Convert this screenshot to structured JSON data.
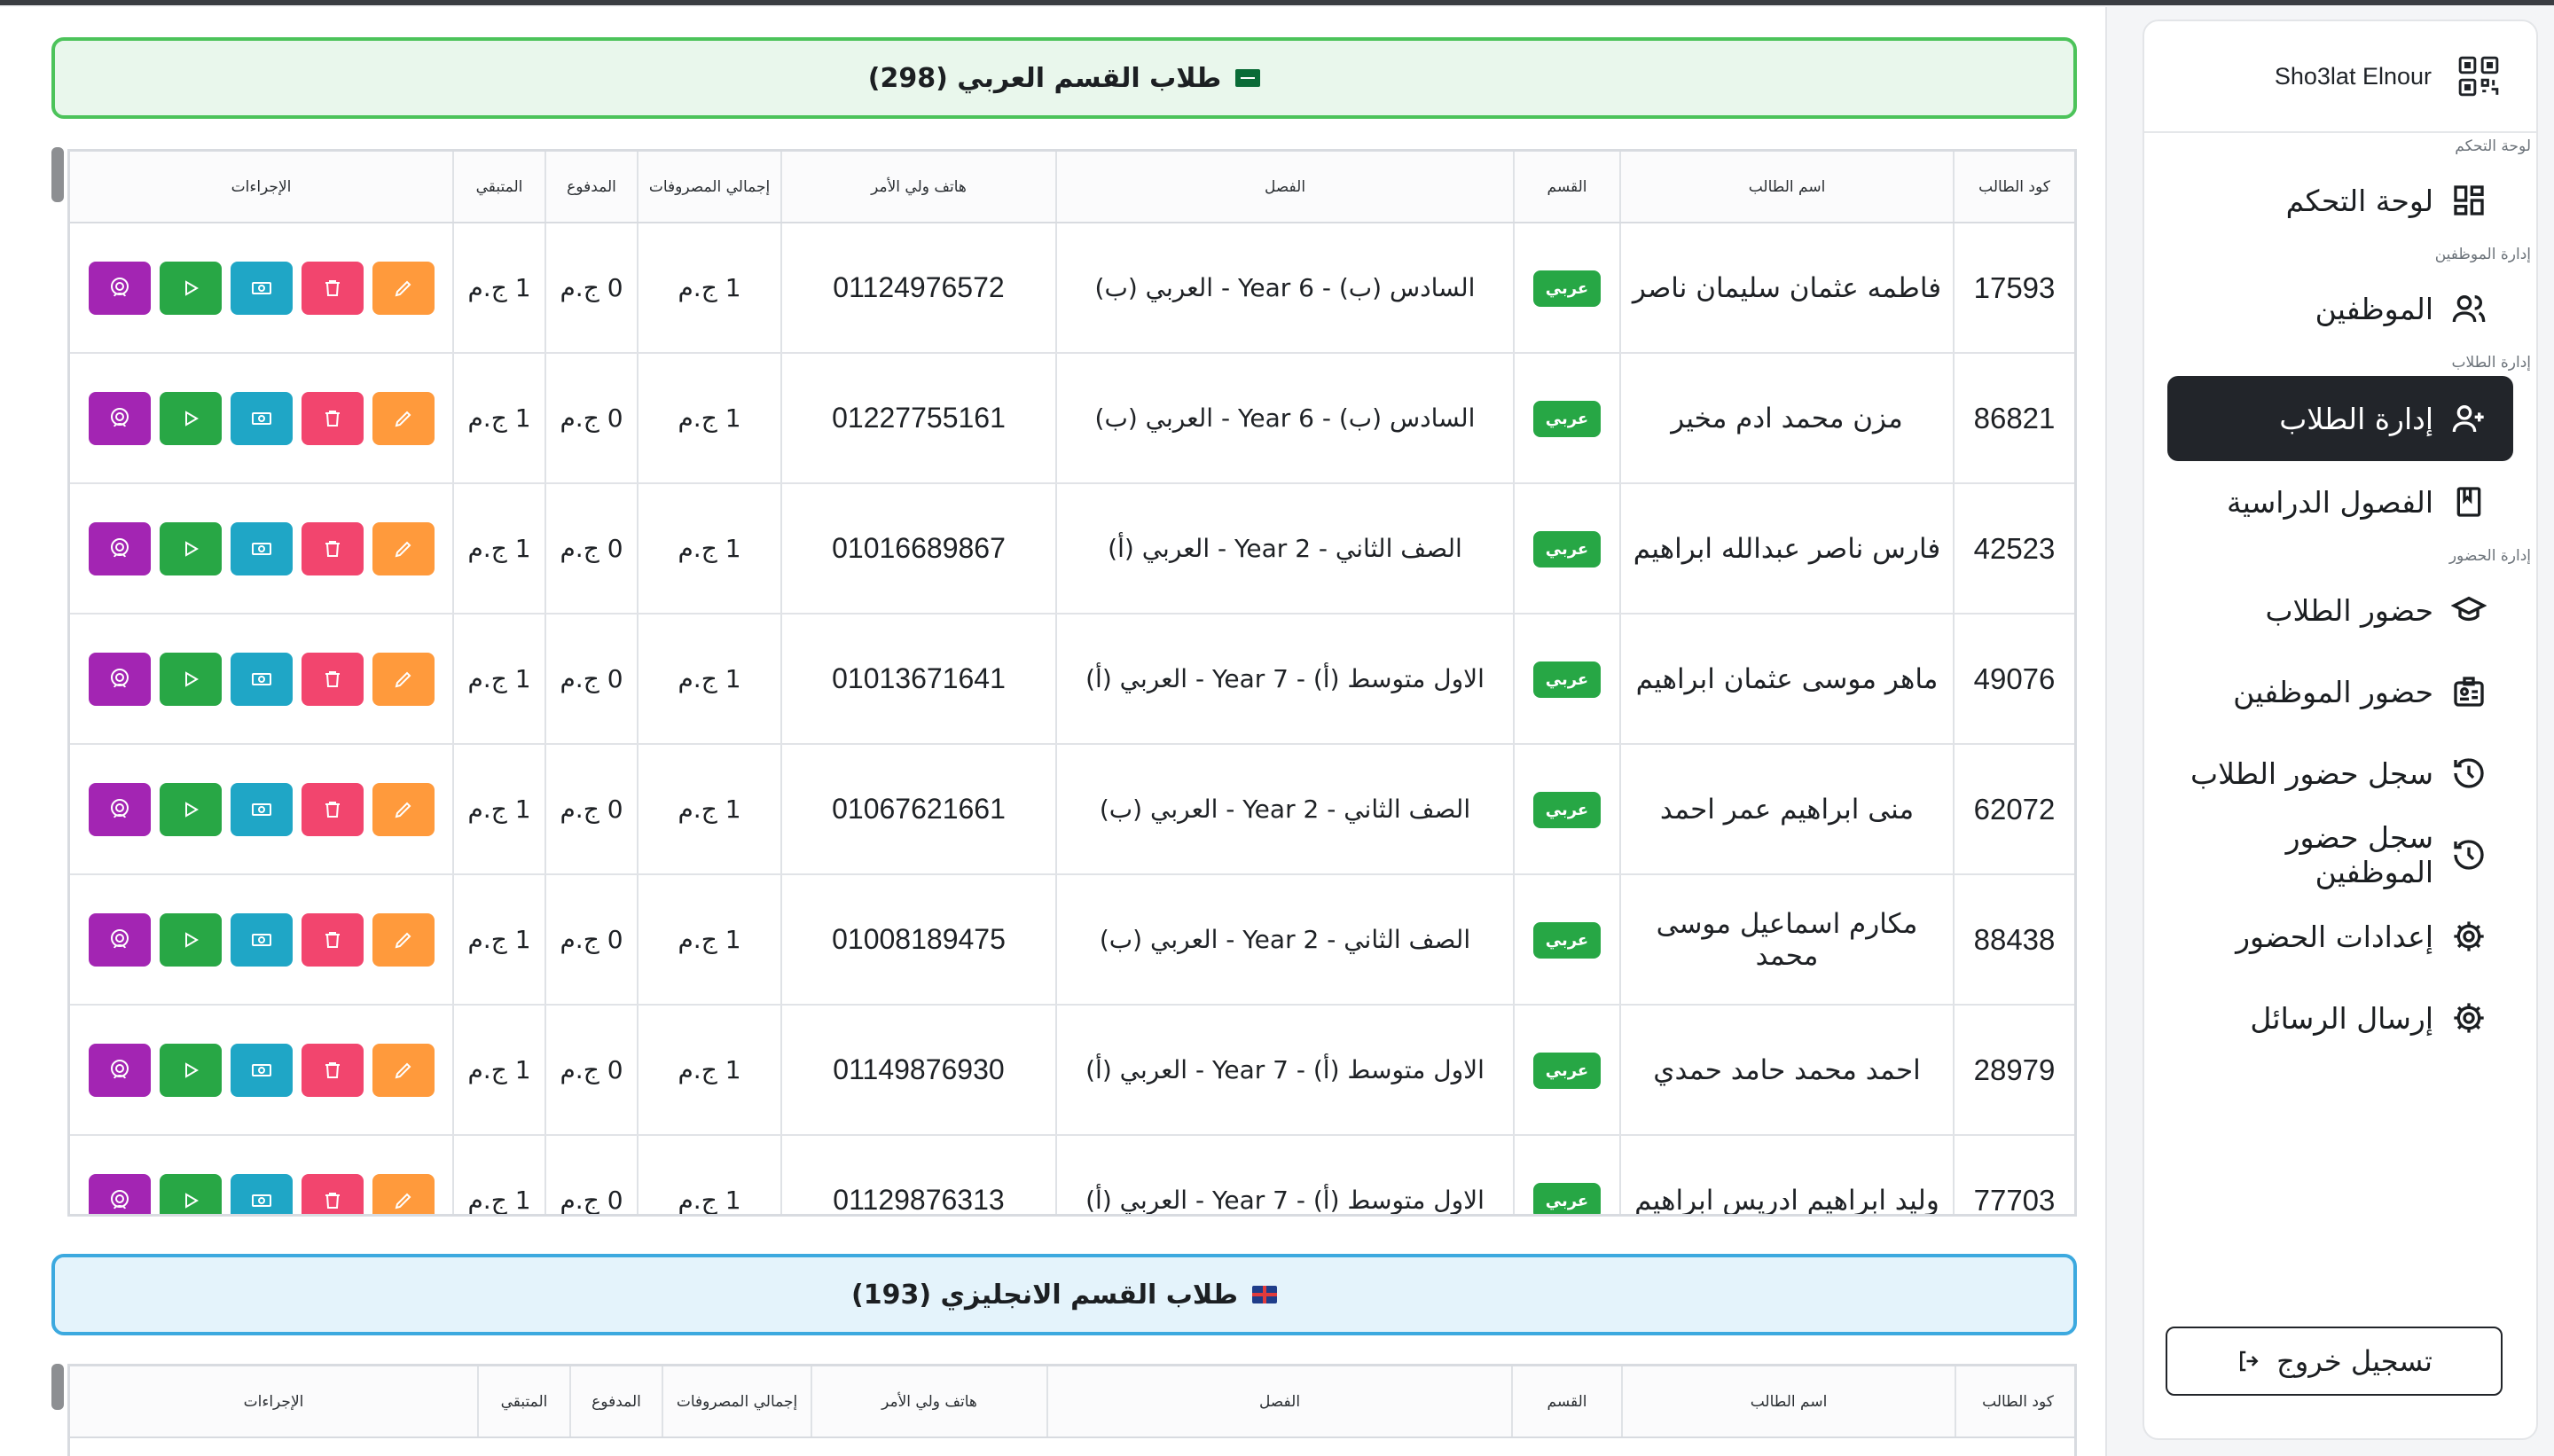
{
  "brand": {
    "name": "Sho3lat Elnour",
    "icon": "qr-boxes-icon"
  },
  "sidebar": {
    "sections": [
      {
        "label": "لوحة التحكم",
        "items": [
          {
            "label": "لوحة التحكم",
            "icon": "dashboard-grid-icon"
          }
        ]
      },
      {
        "label": "إدارة الموظفين",
        "items": [
          {
            "label": "الموظفين",
            "icon": "users-icon"
          }
        ]
      },
      {
        "label": "إدارة الطلاب",
        "items": [
          {
            "label": "إدارة الطلاب",
            "icon": "user-plus-icon",
            "active": true
          },
          {
            "label": "الفصول الدراسية",
            "icon": "book-icon"
          }
        ]
      },
      {
        "label": "إدارة الحضور",
        "items": [
          {
            "label": "حضور الطلاب",
            "icon": "graduation-cap-icon"
          },
          {
            "label": "حضور الموظفين",
            "icon": "id-badge-icon"
          },
          {
            "label": "سجل حضور الطلاب",
            "icon": "history-icon"
          },
          {
            "label": "سجل حضور الموظفين",
            "icon": "history-icon"
          },
          {
            "label": "إعدادات الحضور",
            "icon": "gear-icon"
          },
          {
            "label": "إرسال الرسائل",
            "icon": "gear-icon"
          }
        ]
      }
    ],
    "logout_label": "تسجيل خروج"
  },
  "arabic_section": {
    "title": "طلاب القسم العربي (298)",
    "columns": [
      "كود الطالب",
      "اسم الطالب",
      "القسم",
      "الفصل",
      "هاتف ولي الأمر",
      "إجمالي المصروفات",
      "المدفوع",
      "المتبقي",
      "الإجراءات"
    ],
    "rows": [
      {
        "code": "17593",
        "name": "فاطمه عثمان سليمان ناصر",
        "dept": "عربي",
        "class": "السادس (ب) - Year 6 - العربي (ب)",
        "phone": "01124976572",
        "total": "1 ج.م",
        "paid": "0 ج.م",
        "remaining": "1 ج.م"
      },
      {
        "code": "86821",
        "name": "مزن محمد ادم مخير",
        "dept": "عربي",
        "class": "السادس (ب) - Year 6 - العربي (ب)",
        "phone": "01227755161",
        "total": "1 ج.م",
        "paid": "0 ج.م",
        "remaining": "1 ج.م"
      },
      {
        "code": "42523",
        "name": "فارس ناصر عبدالله ابراهيم",
        "dept": "عربي",
        "class": "الصف الثاني - Year 2 - العربي (أ)",
        "phone": "01016689867",
        "total": "1 ج.م",
        "paid": "0 ج.م",
        "remaining": "1 ج.م"
      },
      {
        "code": "49076",
        "name": "ماهر موسى عثمان ابراهيم",
        "dept": "عربي",
        "class": "الاول متوسط (أ) - Year 7 - العربي (أ)",
        "phone": "01013671641",
        "total": "1 ج.م",
        "paid": "0 ج.م",
        "remaining": "1 ج.م"
      },
      {
        "code": "62072",
        "name": "منى ابراهيم عمر احمد",
        "dept": "عربي",
        "class": "الصف الثاني - Year 2 - العربي (ب)",
        "phone": "01067621661",
        "total": "1 ج.م",
        "paid": "0 ج.م",
        "remaining": "1 ج.م"
      },
      {
        "code": "88438",
        "name": "مكارم اسماعيل موسى محمد",
        "dept": "عربي",
        "class": "الصف الثاني - Year 2 - العربي (ب)",
        "phone": "01008189475",
        "total": "1 ج.م",
        "paid": "0 ج.م",
        "remaining": "1 ج.م"
      },
      {
        "code": "28979",
        "name": "احمد محمد حامد حمدي",
        "dept": "عربي",
        "class": "الاول متوسط (أ) - Year 7 - العربي (أ)",
        "phone": "01149876930",
        "total": "1 ج.م",
        "paid": "0 ج.م",
        "remaining": "1 ج.م"
      },
      {
        "code": "77703",
        "name": "وليد ابراهيم ادريس ابراهيم",
        "dept": "عربي",
        "class": "الاول متوسط (أ) - Year 7 - العربي (أ)",
        "phone": "01129876313",
        "total": "1 ج.م",
        "paid": "0 ج.م",
        "remaining": "1 ج.م"
      }
    ],
    "actions": [
      {
        "name": "edit-button",
        "icon": "pencil-icon",
        "color": "#ff9a3c"
      },
      {
        "name": "delete-button",
        "icon": "trash-icon",
        "color": "#f2456e"
      },
      {
        "name": "payment-button",
        "icon": "money-icon",
        "color": "#1fa6c6"
      },
      {
        "name": "send-button",
        "icon": "play-icon",
        "color": "#28a745"
      },
      {
        "name": "card-button",
        "icon": "id-card-icon",
        "color": "#a325b3"
      }
    ]
  },
  "english_section": {
    "title": "طلاب القسم الانجليزي (193)",
    "columns": [
      "كود الطالب",
      "اسم الطالب",
      "القسم",
      "الفصل",
      "هاتف ولي الأمر",
      "إجمالي المصروفات",
      "المدفوع",
      "المتبقي",
      "الإجراءات"
    ]
  }
}
